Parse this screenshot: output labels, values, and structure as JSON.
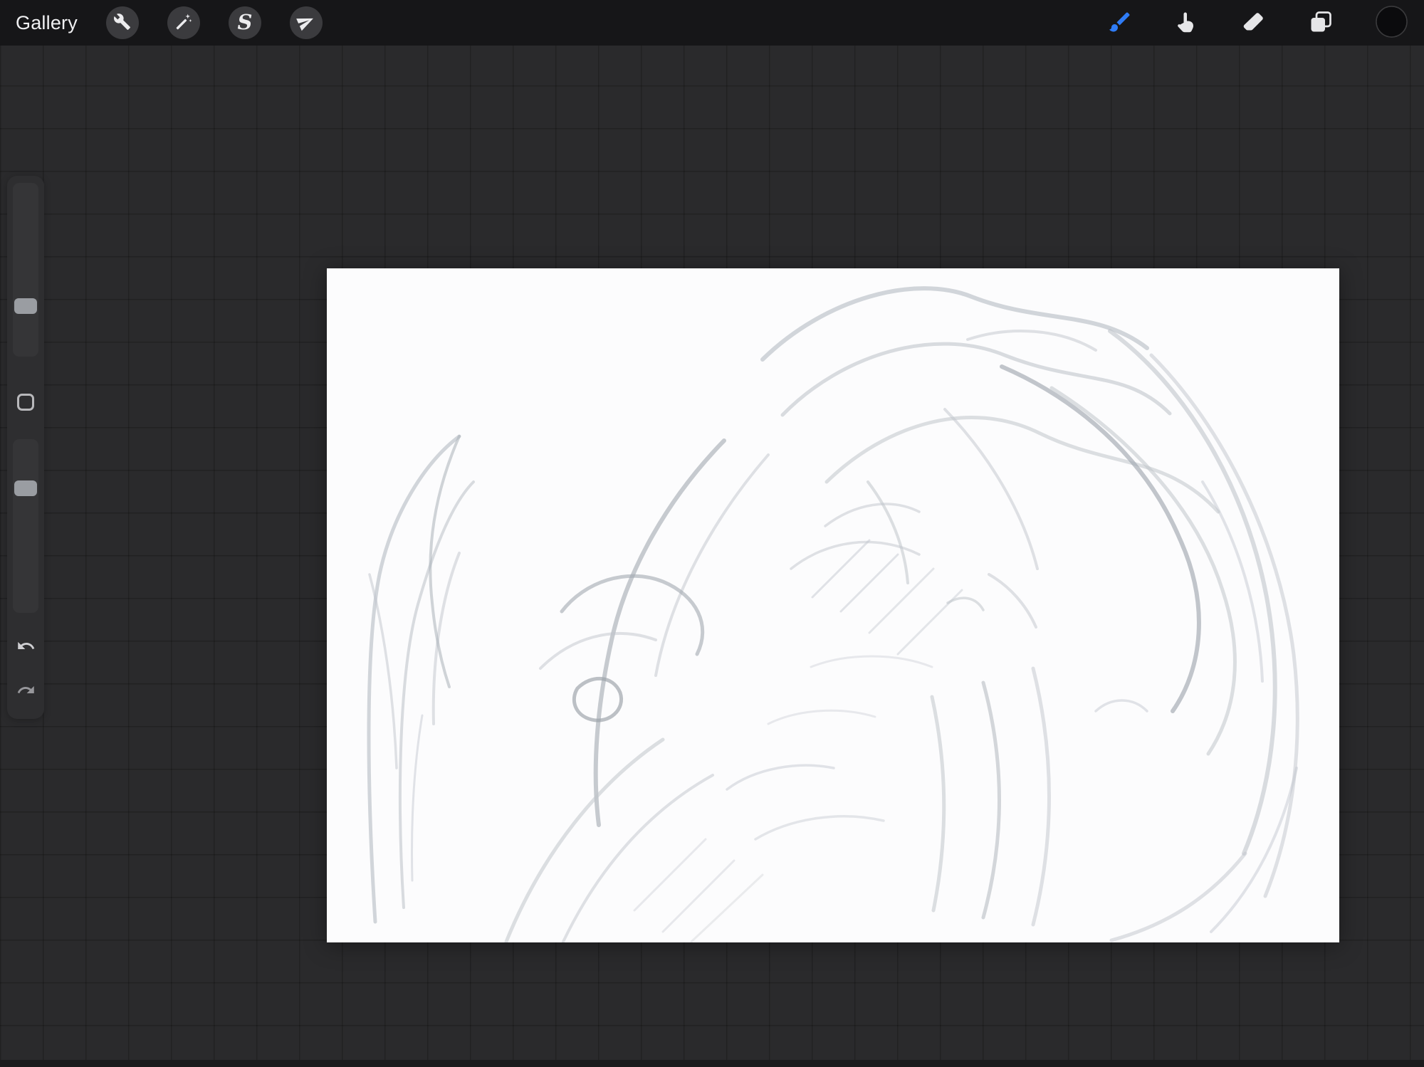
{
  "colors": {
    "accent": "#2f7cf6",
    "swatch": "#0b0b0d"
  },
  "topbar": {
    "gallery_label": "Gallery",
    "left_tools": [
      {
        "name": "actions",
        "icon": "wrench-icon"
      },
      {
        "name": "adjustments",
        "icon": "magic-wand-icon"
      },
      {
        "name": "selection",
        "icon": "selection-s-icon",
        "glyph": "S"
      },
      {
        "name": "transform",
        "icon": "transform-arrow-icon"
      }
    ],
    "right_tools": [
      {
        "name": "paint",
        "icon": "brush-icon",
        "selected": true
      },
      {
        "name": "smudge",
        "icon": "smudge-finger-icon"
      },
      {
        "name": "erase",
        "icon": "eraser-icon"
      },
      {
        "name": "layers",
        "icon": "layers-icon"
      },
      {
        "name": "color",
        "icon": "color-swatch",
        "value": "#0b0b0d"
      }
    ]
  },
  "sidebar": {
    "items": [
      {
        "name": "brush-size-slider"
      },
      {
        "name": "modify-button",
        "icon": "square-icon"
      },
      {
        "name": "opacity-slider"
      },
      {
        "name": "undo-button",
        "icon": "undo-arrow-icon"
      },
      {
        "name": "redo-button",
        "icon": "redo-arrow-icon"
      }
    ]
  },
  "canvas": {
    "description": "pencil gesture sketch of a hunched figure with flowing hair, plant shape at left",
    "stroke_color": "#bfc4cb",
    "strokes": [
      [
        "M68 918 C58 760 52 540 74 430 C92 345 138 272 186 236",
        5,
        0.7
      ],
      [
        "M108 898 C98 740 102 565 128 472 C148 402 174 332 206 300",
        4,
        0.6
      ],
      [
        "M150 640 C148 560 158 470 186 400",
        4,
        0.5
      ],
      [
        "M186 236 C158 300 138 380 148 470 C152 512 160 552 172 588",
        4,
        0.55,
        "#aab0b8"
      ],
      [
        "M60 430 C80 505 94 600 98 702",
        3.5,
        0.5
      ],
      [
        "M120 860 C118 780 122 700 134 628",
        3,
        0.45
      ],
      [
        "M612 128 C700 42 826 8 906 40 C1004 78 1082 58 1152 112",
        6,
        0.7
      ],
      [
        "M640 206 C724 120 854 82 952 122 C1058 164 1122 142 1184 204",
        5,
        0.6
      ],
      [
        "M702 300 C784 220 902 182 1002 232 C1100 280 1178 262 1252 342",
        5,
        0.55
      ],
      [
        "M948 138 C1050 182 1148 262 1198 380 C1240 472 1230 562 1188 622",
        6,
        0.65,
        "#a2a8b0"
      ],
      [
        "M1018 168 C1120 232 1220 332 1258 452 C1288 542 1278 622 1238 682",
        5,
        0.55
      ],
      [
        "M868 198 C930 262 978 342 998 422",
        4,
        0.5
      ],
      [
        "M1100 88 C1202 162 1290 302 1320 462 C1344 592 1330 722 1288 822",
        6,
        0.6
      ],
      [
        "M1158 122 C1258 222 1338 382 1358 542 C1372 662 1358 782 1318 882",
        5,
        0.5
      ],
      [
        "M1230 300 C1280 380 1310 480 1314 580",
        4,
        0.45
      ],
      [
        "M900 100 C960 80 1030 85 1080 115",
        4,
        0.5
      ],
      [
        "M760 300 C792 342 812 392 816 442",
        4,
        0.55
      ],
      [
        "M700 362 C742 330 792 322 832 342",
        3.5,
        0.5
      ],
      [
        "M652 422 C702 382 772 372 832 402",
        3.5,
        0.5
      ],
      [
        "M682 462 L762 382",
        3,
        0.45
      ],
      [
        "M722 482 L802 402",
        3,
        0.45
      ],
      [
        "M762 512 L852 422",
        3,
        0.4
      ],
      [
        "M802 542 L892 452",
        3,
        0.4
      ],
      [
        "M872 470 C892 458 912 462 922 480",
        3.5,
        0.55
      ],
      [
        "M930 430 C958 446 982 472 996 504",
        4,
        0.5
      ],
      [
        "M558 242 C480 322 422 422 400 522 C380 612 372 702 382 782",
        6,
        0.6,
        "#a2a8b0"
      ],
      [
        "M620 262 C542 352 482 462 462 572",
        4,
        0.5
      ],
      [
        "M330 482 C362 440 422 420 472 440 C520 460 540 502 520 542",
        5,
        0.6,
        "#a2a8b0"
      ],
      [
        "M300 562 C342 520 402 500 462 522",
        4,
        0.5
      ],
      [
        "M352 590 C372 570 402 572 412 596 C420 620 396 640 372 634 C348 628 342 606 352 590",
        5,
        0.65,
        "#9aa0a8"
      ],
      [
        "M252 946 C302 822 382 722 472 662",
        5,
        0.55
      ],
      [
        "M332 946 C382 842 452 762 542 712",
        4,
        0.5
      ],
      [
        "M562 732 C602 702 662 692 712 702",
        3.5,
        0.45
      ],
      [
        "M602 802 C652 772 722 762 782 776",
        3.5,
        0.4
      ],
      [
        "M850 602 C872 702 872 802 852 902",
        5,
        0.55
      ],
      [
        "M922 582 C952 692 952 802 922 912",
        5,
        0.5,
        "#aab0b8"
      ],
      [
        "M992 562 C1022 682 1022 802 992 922",
        5,
        0.5
      ],
      [
        "M1290 822 C1242 882 1182 922 1102 944",
        5,
        0.5
      ],
      [
        "M1362 702 C1342 792 1302 872 1242 932",
        4,
        0.45
      ],
      [
        "M432 902 L532 802",
        3,
        0.35
      ],
      [
        "M472 932 L572 832",
        3,
        0.35
      ],
      [
        "M512 946 L612 852",
        3,
        0.3
      ],
      [
        "M1080 622 C1102 602 1132 602 1152 622",
        3.5,
        0.45
      ],
      [
        "M620 640 C660 620 720 615 770 630",
        3,
        0.35
      ],
      [
        "M680 560 C730 540 800 540 850 560",
        3,
        0.35
      ]
    ]
  }
}
